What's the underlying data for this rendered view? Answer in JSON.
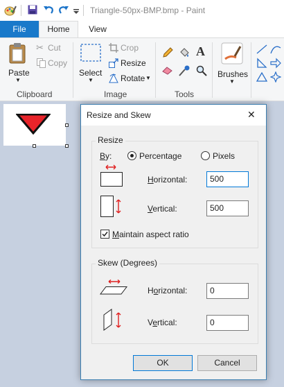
{
  "window": {
    "title": "Triangle-50px-BMP.bmp - Paint"
  },
  "tabs": [
    {
      "label": "File"
    },
    {
      "label": "Home"
    },
    {
      "label": "View"
    }
  ],
  "ribbon": {
    "clipboard": {
      "paste": "Paste",
      "cut": "Cut",
      "copy": "Copy",
      "group": "Clipboard"
    },
    "image": {
      "select": "Select",
      "crop": "Crop",
      "resize": "Resize",
      "rotate": "Rotate",
      "group": "Image"
    },
    "tools": {
      "group": "Tools"
    },
    "brushes": {
      "label": "Brushes"
    }
  },
  "canvas": {
    "shape_color": "#e8242a"
  },
  "dialog": {
    "title": "Resize and Skew",
    "close": "✕",
    "resize": {
      "legend": "Resize",
      "by_label": "By:",
      "options": [
        "Percentage",
        "Pixels"
      ],
      "selected": "Percentage",
      "horizontal_label": "Horizontal:",
      "horizontal_value": "500",
      "vertical_label": "Vertical:",
      "vertical_value": "500",
      "maintain_label": "Maintain aspect ratio",
      "maintain_checked": true
    },
    "skew": {
      "legend": "Skew (Degrees)",
      "horizontal_label": "Horizontal:",
      "horizontal_value": "0",
      "vertical_label": "Vertical:",
      "vertical_value": "0"
    },
    "ok": "OK",
    "cancel": "Cancel"
  }
}
